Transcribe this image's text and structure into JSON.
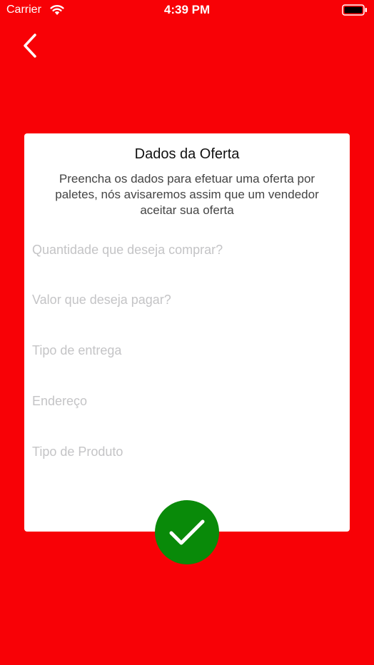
{
  "status_bar": {
    "carrier": "Carrier",
    "time": "4:39 PM",
    "wifi_icon": "wifi-icon",
    "battery_icon": "battery-icon"
  },
  "nav": {
    "back_icon": "chevron-left-icon"
  },
  "card": {
    "title": "Dados da Oferta",
    "subtitle": "Preencha os dados para efetuar uma oferta por paletes, nós avisaremos assim que um vendedor aceitar sua oferta",
    "fields": [
      {
        "placeholder": "Quantidade que deseja comprar?",
        "value": ""
      },
      {
        "placeholder": "Valor que deseja pagar?",
        "value": ""
      },
      {
        "placeholder": "Tipo de entrega",
        "value": ""
      },
      {
        "placeholder": "Endereço",
        "value": ""
      },
      {
        "placeholder": "Tipo de Produto",
        "value": ""
      }
    ]
  },
  "confirm": {
    "icon": "checkmark-icon",
    "color": "#098a09"
  },
  "colors": {
    "background": "#f80106",
    "card": "#ffffff",
    "placeholder": "#c4c4c6"
  }
}
